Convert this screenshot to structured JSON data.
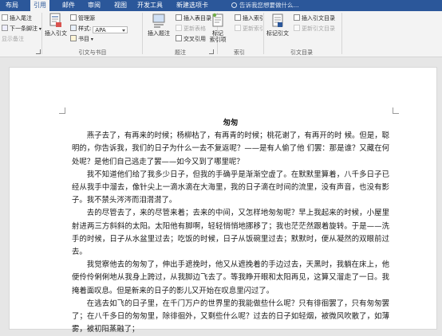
{
  "tabs": [
    "布局",
    "引用",
    "邮件",
    "审阅",
    "视图",
    "开发工具",
    "新建选项卡"
  ],
  "tell_me": "告诉我您想要做什么...",
  "ribbon": {
    "footnote": {
      "insert_endnote": "插入尾注",
      "next_footnote": "下一条脚注",
      "show_notes": "显示备注"
    },
    "citations": {
      "insert_citation": "插入引文",
      "manage_sources": "管理源",
      "style_label": "样式:",
      "style_value": "APA",
      "bibliography": "书目",
      "group_label": "引文与书目"
    },
    "captions": {
      "insert_caption": "插入题注",
      "insert_table_of_figures": "插入表目录",
      "update_table": "更新表格",
      "cross_reference": "交叉引用",
      "group_label": "题注"
    },
    "index": {
      "mark_entry": "标记\n索引项",
      "insert_index": "插入索引",
      "update_index": "更新索引",
      "group_label": "索引"
    },
    "toa": {
      "mark_citation": "标记引文",
      "insert_toa": "插入引文目录",
      "update_toa": "更新引文目录",
      "group_label": "引文目录"
    }
  },
  "document": {
    "title": "匆匆",
    "paragraphs": [
      "燕子去了，有再来的时候；杨柳枯了，有再青的时候；桃花谢了，有再开的时 候。但是，聪明的，你告诉我，我们的日子为什么一去不复返呢？——是有人偷了他 们罢：那是谁？又藏在何处呢？是他们自己逃走了罢——如今又到了哪里呢？",
      "我不知道他们给了我多少日子，但我的手确乎是渐渐空虚了。在默默里算着，八千多日子已经从我手中溜去，像针尖上一滴水滴在大海里，我的日子滴在时间的流里，没有声音，也没有影子。我不禁头涔涔而泪潸潸了。",
      "去的尽管去了，来的尽管来着；去来的中间，又怎样地匆匆呢？早上我起来的时候，小屋里射进两三方斜斜的太阳。太阳他有脚啊，轻轻悄悄地挪移了；我也茫茫然跟着旋转。于是——洗手的时候，日子从水盆里过去；吃饭的时候，日子从饭碗里过去；默默时，便从凝然的双眼前过去。",
      "我觉察他去的匆匆了，伸出手遮挽时，他又从遮挽着的手边过去，天黑时，我躺在床上，他便伶伶俐俐地从我身上跨过，从我脚边飞去了。等我睁开眼和太阳再见，这算又溜走了一日。我掩着面叹息。但是新来的日子的影儿又开始在叹息里闪过了。",
      "在逃去如飞的日子里，在千门万户的世界里的我能做些什么呢？只有徘徊罢了，只有匆匆罢了；在八千多日的匆匆里，除徘徊外，又剩些什么呢？过去的日子如轻烟，被微风吹散了，如薄雾，被初阳蒸融了；"
    ]
  }
}
